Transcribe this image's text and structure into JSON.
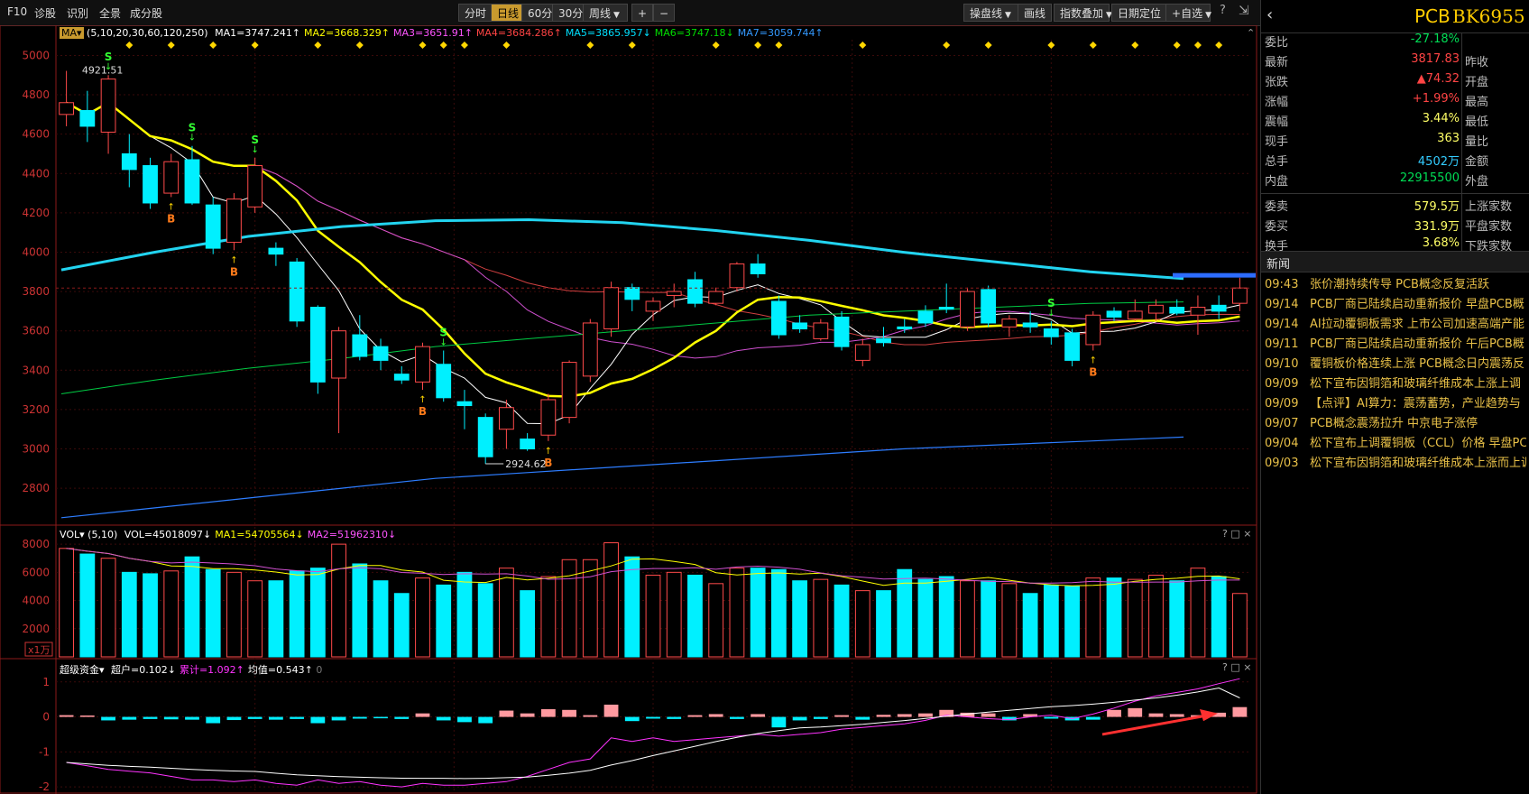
{
  "toolbar": {
    "left": [
      "F10",
      "诊股",
      "识別",
      "全景",
      "成分股"
    ],
    "periods": [
      "分时",
      "日线",
      "60分",
      "30分",
      "周线"
    ],
    "active_period": "日线",
    "right": [
      "操盘线",
      "画线",
      "指数叠加",
      "日期定位",
      "自选"
    ]
  },
  "ma_legend": {
    "name": "MA",
    "params": "(5,10,20,30,60,120,250)",
    "items": [
      {
        "label": "MA1=3747.241",
        "color": "#ffffff"
      },
      {
        "label": "MA2=3668.329",
        "color": "#ffff00"
      },
      {
        "label": "MA3=3651.91",
        "color": "#ff55ff"
      },
      {
        "label": "MA4=3684.286",
        "color": "#ff4444"
      },
      {
        "label": "MA5=3865.957",
        "color": "#00e0ff"
      },
      {
        "label": "MA6=3747.18",
        "color": "#00dd00"
      },
      {
        "label": "MA7=3059.744",
        "color": "#3399ff"
      }
    ],
    "arrows": [
      "↑",
      "↑",
      "↑",
      "↑",
      "↓",
      "↓",
      "↑"
    ]
  },
  "vol_legend": {
    "name": "VOL",
    "params": "(5,10)",
    "items": [
      {
        "label": "VOL=45018097",
        "color": "#ffffff",
        "arrow": "↓"
      },
      {
        "label": "MA1=54705564",
        "color": "#ffff00",
        "arrow": "↓"
      },
      {
        "label": "MA2=51962310",
        "color": "#ff55ff",
        "arrow": "↓"
      }
    ],
    "unit": "x1万"
  },
  "fund_legend": {
    "name": "超级资金",
    "items": [
      {
        "label": "超户=0.102",
        "color": "#ffffff",
        "arrow": "↓"
      },
      {
        "label": "累计=1.092",
        "color": "#ff33ff",
        "arrow": "↑"
      },
      {
        "label": "均值=0.543",
        "color": "#ffffff",
        "arrow": "↑"
      }
    ],
    "extra": "0"
  },
  "annotations": {
    "high_label": "4921.51",
    "low_label": "2924.62"
  },
  "panel_controls": [
    "?",
    "□",
    "×"
  ],
  "chart_data": [
    {
      "type": "candlestick",
      "ylim": [
        2640,
        5080
      ],
      "yticks": [
        2800,
        3000,
        3200,
        3400,
        3600,
        3800,
        4000,
        4200,
        4400,
        4600,
        4800,
        5000
      ],
      "candles": [
        [
          4700,
          4760,
          4640,
          4921.51
        ],
        [
          4720,
          4640,
          4560,
          4820
        ],
        [
          4610,
          4880,
          4500,
          4900
        ],
        [
          4500,
          4420,
          4330,
          4600
        ],
        [
          4440,
          4250,
          4220,
          4480
        ],
        [
          4300,
          4460,
          4280,
          4500
        ],
        [
          4470,
          4250,
          4240,
          4540
        ],
        [
          4240,
          4020,
          3990,
          4280
        ],
        [
          4050,
          4270,
          4010,
          4300
        ],
        [
          4230,
          4440,
          4200,
          4480
        ],
        [
          4020,
          3990,
          3930,
          4050
        ],
        [
          3950,
          3650,
          3620,
          3970
        ],
        [
          3720,
          3340,
          3280,
          3730
        ],
        [
          3360,
          3600,
          3080,
          3620
        ],
        [
          3580,
          3470,
          3450,
          3680
        ],
        [
          3520,
          3450,
          3400,
          3560
        ],
        [
          3380,
          3350,
          3330,
          3420
        ],
        [
          3340,
          3520,
          3300,
          3540
        ],
        [
          3430,
          3260,
          3240,
          3500
        ],
        [
          3240,
          3220,
          3100,
          3300
        ],
        [
          3160,
          2960,
          2924.62,
          3180
        ],
        [
          3100,
          3210,
          3000,
          3250
        ],
        [
          3050,
          3000,
          2990,
          3080
        ],
        [
          3070,
          3250,
          3040,
          3280
        ],
        [
          3160,
          3440,
          3130,
          3450
        ],
        [
          3370,
          3640,
          3340,
          3660
        ],
        [
          3610,
          3820,
          3570,
          3850
        ],
        [
          3820,
          3760,
          3700,
          3840
        ],
        [
          3700,
          3750,
          3650,
          3770
        ],
        [
          3780,
          3800,
          3720,
          3840
        ],
        [
          3860,
          3740,
          3720,
          3900
        ],
        [
          3740,
          3800,
          3730,
          3820
        ],
        [
          3820,
          3940,
          3800,
          3950
        ],
        [
          3940,
          3890,
          3870,
          3990
        ],
        [
          3750,
          3580,
          3560,
          3780
        ],
        [
          3640,
          3610,
          3590,
          3680
        ],
        [
          3560,
          3640,
          3550,
          3660
        ],
        [
          3670,
          3520,
          3500,
          3700
        ],
        [
          3450,
          3530,
          3420,
          3560
        ],
        [
          3560,
          3540,
          3520,
          3620
        ],
        [
          3620,
          3610,
          3590,
          3660
        ],
        [
          3700,
          3640,
          3620,
          3730
        ],
        [
          3720,
          3710,
          3690,
          3840
        ],
        [
          3620,
          3800,
          3600,
          3820
        ],
        [
          3810,
          3640,
          3620,
          3830
        ],
        [
          3620,
          3660,
          3570,
          3680
        ],
        [
          3640,
          3620,
          3590,
          3700
        ],
        [
          3610,
          3570,
          3530,
          3650
        ],
        [
          3590,
          3450,
          3420,
          3610
        ],
        [
          3530,
          3680,
          3500,
          3700
        ],
        [
          3700,
          3670,
          3650,
          3720
        ],
        [
          3660,
          3700,
          3650,
          3760
        ],
        [
          3690,
          3730,
          3650,
          3760
        ],
        [
          3720,
          3690,
          3680,
          3760
        ],
        [
          3680,
          3720,
          3580,
          3780
        ],
        [
          3730,
          3700,
          3660,
          3780
        ],
        [
          3740,
          3817.83,
          3700,
          3870
        ]
      ]
    },
    {
      "type": "bar",
      "ylim": [
        0,
        8200
      ],
      "yticks": [
        2000,
        4000,
        6000,
        8000
      ],
      "values": [
        7700,
        7300,
        7000,
        6000,
        5900,
        6100,
        7100,
        6200,
        6000,
        5400,
        5400,
        6100,
        6300,
        8000,
        6600,
        5400,
        4500,
        5600,
        5100,
        6000,
        5200,
        6300,
        4700,
        5700,
        6900,
        6900,
        8100,
        7100,
        5800,
        6000,
        5800,
        5200,
        6300,
        6300,
        6200,
        5400,
        5500,
        5100,
        4700,
        4700,
        6200,
        5500,
        5700,
        5400,
        5400,
        5200,
        4500,
        5100,
        5000,
        5600,
        5600,
        5500,
        5800,
        5400,
        6300,
        5700,
        4500
      ]
    },
    {
      "type": "bar",
      "ylim": [
        -2.1,
        1.2
      ],
      "yticks": [
        -2,
        -1,
        0,
        1
      ],
      "values": [
        0.05,
        0.04,
        -0.1,
        -0.08,
        -0.06,
        -0.07,
        -0.08,
        -0.18,
        -0.09,
        -0.06,
        -0.08,
        -0.06,
        -0.18,
        -0.1,
        -0.05,
        -0.04,
        -0.06,
        0.1,
        -0.1,
        -0.15,
        -0.18,
        0.18,
        0.1,
        0.22,
        0.2,
        0.05,
        0.35,
        -0.12,
        -0.05,
        -0.06,
        0.05,
        0.08,
        -0.06,
        0.08,
        -0.3,
        -0.1,
        -0.06,
        0.05,
        -0.08,
        0.06,
        0.08,
        0.1,
        0.2,
        0.12,
        0.1,
        -0.1,
        0.08,
        -0.05,
        -0.1,
        -0.08,
        0.2,
        0.25,
        0.1,
        0.08,
        0.05,
        0.12,
        0.28
      ]
    }
  ],
  "right_panel": {
    "code": "PCB",
    "name": "BK6955",
    "quote": [
      {
        "k": "委比",
        "v": "-27.18%",
        "c": "#00dd55",
        "k2": ""
      },
      {
        "k": "最新",
        "v": "3817.83",
        "c": "#ff4444",
        "k2": "昨收"
      },
      {
        "k": "张跌",
        "v": "▲74.32",
        "c": "#ff4444",
        "k2": "开盘"
      },
      {
        "k": "涨幅",
        "v": "+1.99%",
        "c": "#ff4444",
        "k2": "最高"
      },
      {
        "k": "震幅",
        "v": "3.44%",
        "c": "#ffff66",
        "k2": "最低"
      },
      {
        "k": "现手",
        "v": "363",
        "c": "#ffff66",
        "k2": "量比"
      },
      {
        "k": "总手",
        "v": "4502万",
        "c": "#33ccff",
        "k2": "金额"
      },
      {
        "k": "内盘",
        "v": "22915500",
        "c": "#00dd55",
        "k2": "外盘"
      },
      {
        "k": "委卖",
        "v": "579.5万",
        "c": "#ffff66",
        "k2": "上涨家数"
      },
      {
        "k": "委买",
        "v": "331.9万",
        "c": "#ffff66",
        "k2": "平盘家数"
      },
      {
        "k": "换手",
        "v": "3.68%",
        "c": "#ffff66",
        "k2": "下跌家数"
      }
    ],
    "news_title": "新闻",
    "news": [
      {
        "t": "09:43",
        "s": "张价潮持续传导 PCB概念反复活跃"
      },
      {
        "t": "09/14",
        "s": "PCB厂商已陆续启动重新报价 早盘PCB概"
      },
      {
        "t": "09/14",
        "s": "AI拉动覆铜板需求 上市公司加速高端产能"
      },
      {
        "t": "09/11",
        "s": "PCB厂商已陆续启动重新报价 午后PCB概"
      },
      {
        "t": "09/10",
        "s": "覆铜板价格连续上涨 PCB概念日内震荡反"
      },
      {
        "t": "09/09",
        "s": "松下宣布因铜箔和玻璃纤维成本上涨上调"
      },
      {
        "t": "09/09",
        "s": "【点评】AI算力：震荡蓄势，产业趋势与"
      },
      {
        "t": "09/07",
        "s": "PCB概念震荡拉升 中京电子涨停"
      },
      {
        "t": "09/04",
        "s": "松下宣布上调覆铜板（CCL）价格 早盘PC"
      },
      {
        "t": "09/03",
        "s": "松下宣布因铜箔和玻璃纤维成本上涨而上调"
      }
    ]
  }
}
